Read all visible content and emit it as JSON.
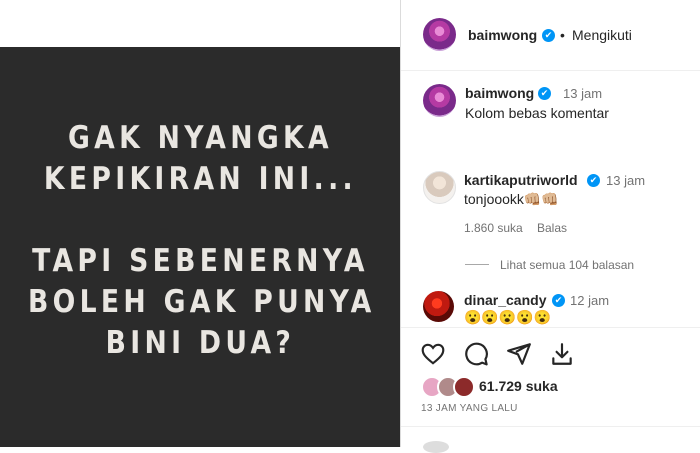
{
  "post": {
    "lines": [
      "GAK NYANGKA",
      "KEPIKIRAN INI...",
      "TAPI SEBENERNYA",
      "BOLEH GAK PUNYA",
      "BINI DUA?"
    ]
  },
  "header": {
    "username": "baimwong",
    "separator": "•",
    "follow_status": "Mengikuti"
  },
  "caption": {
    "username": "baimwong",
    "time": "13 jam",
    "text": "Kolom bebas komentar"
  },
  "comments": [
    {
      "username": "kartikaputriworld",
      "time": "13 jam",
      "text": "tonjoookk👊🏼👊🏼",
      "likes": "1.860 suka",
      "reply_label": "Balas",
      "view_replies": "Lihat semua 104 balasan"
    },
    {
      "username": "dinar_candy",
      "time": "12 jam",
      "text": "😮😮😮😮😮"
    }
  ],
  "actions": {
    "like_count": "61.729 suka",
    "timestamp": "13 JAM YANG LALU"
  },
  "icons": {
    "verified": "verified-badge-icon",
    "like": "heart-icon",
    "comment": "comment-bubble-icon",
    "share": "paper-plane-icon",
    "save": "save-download-icon"
  },
  "colors": {
    "verified": "#0095f6",
    "post_bg": "#2b2b2b",
    "post_text": "#e9e6e1"
  }
}
